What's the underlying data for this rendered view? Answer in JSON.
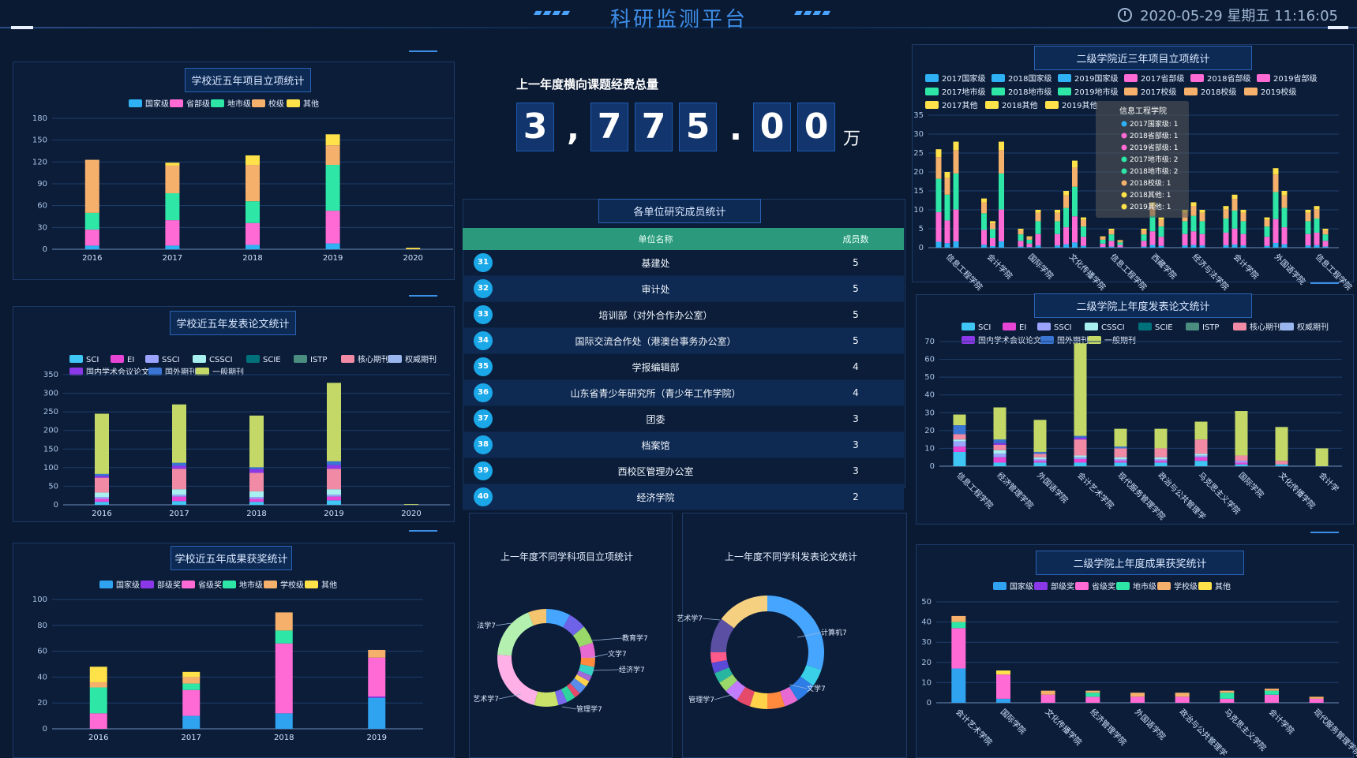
{
  "header": {
    "title": "科研监测平台",
    "datetime": "2020-05-29 星期五 11:16:05"
  },
  "summary": {
    "caption": "上一年度横向课题经费总量",
    "digits": [
      "3",
      ",",
      "7",
      "7",
      "5",
      ".",
      "0",
      "0"
    ],
    "unit": "万"
  },
  "member_table": {
    "title": "各单位研究成员统计",
    "columns": [
      "单位名称",
      "成员数"
    ],
    "rows": [
      {
        "rank": "31",
        "name": "基建处",
        "count": "5"
      },
      {
        "rank": "32",
        "name": "审计处",
        "count": "5"
      },
      {
        "rank": "33",
        "name": "培训部（对外合作办公室）",
        "count": "5"
      },
      {
        "rank": "34",
        "name": "国际交流合作处（港澳台事务办公室）",
        "count": "5"
      },
      {
        "rank": "35",
        "name": "学报编辑部",
        "count": "4"
      },
      {
        "rank": "36",
        "name": "山东省青少年研究所（青少年工作学院）",
        "count": "4"
      },
      {
        "rank": "37",
        "name": "团委",
        "count": "3"
      },
      {
        "rank": "38",
        "name": "档案馆",
        "count": "3"
      },
      {
        "rank": "39",
        "name": "西校区管理办公室",
        "count": "3"
      },
      {
        "rank": "40",
        "name": "经济学院",
        "count": "2"
      }
    ]
  },
  "chart_data": [
    {
      "id": "c1",
      "type": "bar",
      "title": "学校近五年项目立项统计",
      "categories": [
        "2016",
        "2017",
        "2018",
        "2019",
        "2020"
      ],
      "ylim": [
        0,
        180
      ],
      "yticks": [
        0,
        30,
        60,
        90,
        120,
        150,
        180
      ],
      "series": [
        {
          "name": "国家级",
          "color": "#2fb2f5",
          "values": [
            5,
            5,
            6,
            8,
            0
          ]
        },
        {
          "name": "省部级",
          "color": "#ff6ad5",
          "values": [
            22,
            35,
            30,
            45,
            0
          ]
        },
        {
          "name": "地市级",
          "color": "#2ee6a6",
          "values": [
            23,
            37,
            30,
            63,
            0
          ]
        },
        {
          "name": "校级",
          "color": "#f5b06b",
          "values": [
            73,
            38,
            50,
            27,
            0
          ]
        },
        {
          "name": "其他",
          "color": "#ffe14a",
          "values": [
            0,
            4,
            13,
            15,
            2
          ]
        }
      ]
    },
    {
      "id": "c2",
      "type": "bar",
      "title": "学校近五年发表论文统计",
      "categories": [
        "2016",
        "2017",
        "2018",
        "2019",
        "2020"
      ],
      "ylim": [
        0,
        350
      ],
      "yticks": [
        0,
        50,
        100,
        150,
        200,
        250,
        300,
        350
      ],
      "series": [
        {
          "name": "SCI",
          "color": "#3fc6f5",
          "values": [
            8,
            10,
            8,
            12,
            0
          ]
        },
        {
          "name": "EI",
          "color": "#e845d5",
          "values": [
            8,
            12,
            8,
            10,
            0
          ]
        },
        {
          "name": "SSCI",
          "color": "#9aa4ff",
          "values": [
            5,
            5,
            5,
            5,
            0
          ]
        },
        {
          "name": "CSSCI",
          "color": "#a8f0f0",
          "values": [
            12,
            15,
            15,
            15,
            0
          ]
        },
        {
          "name": "SCIE",
          "color": "#00707a",
          "values": [
            0,
            0,
            0,
            0,
            0
          ]
        },
        {
          "name": "ISTP",
          "color": "#4a8d80",
          "values": [
            0,
            0,
            0,
            0,
            0
          ]
        },
        {
          "name": "核心期刊",
          "color": "#f08aa5",
          "values": [
            40,
            55,
            50,
            55,
            0
          ]
        },
        {
          "name": "权威期刊",
          "color": "#9ab6ee",
          "values": [
            0,
            0,
            0,
            0,
            0
          ]
        },
        {
          "name": "国内学术会议论文集",
          "color": "#8b38e8",
          "values": [
            5,
            8,
            10,
            10,
            0
          ]
        },
        {
          "name": "国外期刊",
          "color": "#3a75d4",
          "values": [
            5,
            8,
            5,
            10,
            0
          ]
        },
        {
          "name": "一般期刊",
          "color": "#c4d868",
          "values": [
            162,
            157,
            139,
            211,
            2
          ]
        }
      ]
    },
    {
      "id": "c3",
      "type": "bar",
      "title": "学校近五年成果获奖统计",
      "categories": [
        "2016",
        "2017",
        "2018",
        "2019"
      ],
      "ylim": [
        0,
        100
      ],
      "yticks": [
        0,
        20,
        40,
        60,
        80,
        100
      ],
      "series": [
        {
          "name": "国家级",
          "color": "#2fa2f0",
          "values": [
            0,
            10,
            12,
            24
          ]
        },
        {
          "name": "部级奖",
          "color": "#8b38e8",
          "values": [
            0,
            0,
            0,
            1
          ]
        },
        {
          "name": "省级奖",
          "color": "#ff6ad5",
          "values": [
            12,
            20,
            54,
            30
          ]
        },
        {
          "name": "地市级",
          "color": "#2ee6a6",
          "values": [
            20,
            5,
            10,
            0
          ]
        },
        {
          "name": "学校级",
          "color": "#f5b06b",
          "values": [
            4,
            5,
            14,
            6
          ]
        },
        {
          "name": "其他",
          "color": "#ffe14a",
          "values": [
            12,
            4,
            0,
            0
          ]
        }
      ]
    },
    {
      "id": "c4",
      "type": "bar",
      "title": "二级学院近三年项目立项统计",
      "categories": [
        "信息工程学院",
        "会计学院",
        "国际学院",
        "文化传播学院",
        "信息工程学院",
        "西藏学院",
        "经济与法学院",
        "会计学院",
        "外国语学院",
        "信息工程学院"
      ],
      "ylim": [
        0,
        35
      ],
      "yticks": [
        0,
        5,
        10,
        15,
        20,
        25,
        30,
        35
      ],
      "legend": [
        {
          "name": "2017国家级",
          "color": "#2fb2f5"
        },
        {
          "name": "2018国家级",
          "color": "#2fb2f5"
        },
        {
          "name": "2019国家级",
          "color": "#2fb2f5"
        },
        {
          "name": "2017省部级",
          "color": "#ff6ad5"
        },
        {
          "name": "2018省部级",
          "color": "#ff6ad5"
        },
        {
          "name": "2019省部级",
          "color": "#ff6ad5"
        },
        {
          "name": "2017地市级",
          "color": "#2ee6a6"
        },
        {
          "name": "2018地市级",
          "color": "#2ee6a6"
        },
        {
          "name": "2019地市级",
          "color": "#2ee6a6"
        },
        {
          "name": "2017校级",
          "color": "#f5b06b"
        },
        {
          "name": "2018校级",
          "color": "#f5b06b"
        },
        {
          "name": "2019校级",
          "color": "#f5b06b"
        },
        {
          "name": "2017其他",
          "color": "#ffe14a"
        },
        {
          "name": "2018其他",
          "color": "#ffe14a"
        },
        {
          "name": "2019其他",
          "color": "#ffe14a"
        }
      ],
      "groups": [
        [
          26,
          20,
          28
        ],
        [
          0,
          13,
          7,
          28
        ],
        [
          5,
          3,
          10
        ],
        [
          10,
          15,
          23,
          8
        ],
        [
          3,
          5,
          2
        ],
        [
          5,
          12,
          8
        ],
        [
          10,
          12,
          10
        ],
        [
          11,
          14,
          10
        ],
        [
          8,
          21,
          15
        ],
        [
          10,
          11,
          5
        ]
      ],
      "tooltip": {
        "title": "信息工程学院",
        "items": [
          {
            "label": "2017国家级: 1",
            "color": "#2fb2f5"
          },
          {
            "label": "2018省部级: 1",
            "color": "#ff6ad5"
          },
          {
            "label": "2019省部级: 1",
            "color": "#ff6ad5"
          },
          {
            "label": "2017地市级: 2",
            "color": "#2ee6a6"
          },
          {
            "label": "2018地市级: 2",
            "color": "#2ee6a6"
          },
          {
            "label": "2018校级: 1",
            "color": "#f5b06b"
          },
          {
            "label": "2018其他: 1",
            "color": "#ffe14a"
          },
          {
            "label": "2019其他: 1",
            "color": "#ffe14a"
          }
        ]
      }
    },
    {
      "id": "c5",
      "type": "bar",
      "title": "二级学院上年度发表论文统计",
      "categories": [
        "信息工程学院",
        "经济管理学院",
        "外国语学院",
        "会计艺术学院",
        "现代服务管理学院",
        "政治与公共管理学",
        "马克思主义学院",
        "国际学院",
        "文化传播学院",
        "会计学"
      ],
      "ylim": [
        0,
        70
      ],
      "yticks": [
        0,
        10,
        20,
        30,
        40,
        50,
        60,
        70
      ],
      "series": [
        {
          "name": "SCI",
          "color": "#3fc6f5",
          "values": [
            8,
            2,
            2,
            2,
            2,
            2,
            3,
            1,
            1,
            0
          ]
        },
        {
          "name": "EI",
          "color": "#e845d5",
          "values": [
            3,
            3,
            1,
            2,
            1,
            1,
            2,
            1,
            0,
            0
          ]
        },
        {
          "name": "SSCI",
          "color": "#9aa4ff",
          "values": [
            3,
            2,
            1,
            1,
            1,
            1,
            1,
            1,
            0,
            0
          ]
        },
        {
          "name": "CSSCI",
          "color": "#a8f0f0",
          "values": [
            1,
            2,
            1,
            1,
            1,
            1,
            1,
            0,
            0,
            0
          ]
        },
        {
          "name": "SCIE",
          "color": "#00707a",
          "values": [
            0,
            0,
            0,
            0,
            0,
            0,
            0,
            0,
            0,
            0
          ]
        },
        {
          "name": "ISTP",
          "color": "#4a8d80",
          "values": [
            0,
            0,
            0,
            0,
            0,
            0,
            0,
            0,
            0,
            0
          ]
        },
        {
          "name": "核心期刊",
          "color": "#f08aa5",
          "values": [
            3,
            3,
            2,
            9,
            5,
            5,
            8,
            3,
            2,
            0
          ]
        },
        {
          "name": "权威期刊",
          "color": "#9ab6ee",
          "values": [
            0,
            0,
            0,
            0,
            0,
            0,
            0,
            0,
            0,
            0
          ]
        },
        {
          "name": "国内学术会议论文集",
          "color": "#8b38e8",
          "values": [
            0,
            1,
            0,
            1,
            0,
            0,
            0,
            0,
            0,
            0
          ]
        },
        {
          "name": "国外期刊",
          "color": "#3a75d4",
          "values": [
            5,
            2,
            1,
            1,
            1,
            0,
            0,
            0,
            0,
            0
          ]
        },
        {
          "name": "一般期刊",
          "color": "#c4d868",
          "values": [
            6,
            18,
            18,
            52,
            10,
            11,
            10,
            25,
            19,
            10
          ]
        }
      ]
    },
    {
      "id": "c6",
      "type": "bar",
      "title": "二级学院上年度成果获奖统计",
      "categories": [
        "会计艺术学院",
        "国际学院",
        "文化传播学院",
        "经济管理学院",
        "外国语学院",
        "政治与公共管理学",
        "马克思主义学院",
        "会计学院",
        "现代服务管理学院"
      ],
      "ylim": [
        0,
        50
      ],
      "yticks": [
        0,
        10,
        20,
        30,
        40,
        50
      ],
      "series": [
        {
          "name": "国家级",
          "color": "#2fa2f0",
          "values": [
            17,
            2,
            0,
            0,
            0,
            0,
            0,
            0,
            0
          ]
        },
        {
          "name": "部级奖",
          "color": "#8b38e8",
          "values": [
            0,
            0,
            0,
            0,
            0,
            0,
            0,
            0,
            0
          ]
        },
        {
          "name": "省级奖",
          "color": "#ff6ad5",
          "values": [
            20,
            12,
            4,
            3,
            3,
            3,
            2,
            4,
            2
          ]
        },
        {
          "name": "地市级",
          "color": "#2ee6a6",
          "values": [
            3,
            0,
            0,
            2,
            0,
            0,
            3,
            2,
            0
          ]
        },
        {
          "name": "学校级",
          "color": "#f5b06b",
          "values": [
            3,
            0,
            2,
            1,
            2,
            2,
            1,
            1,
            1
          ]
        },
        {
          "name": "其他",
          "color": "#ffe14a",
          "values": [
            0,
            2,
            0,
            0,
            0,
            0,
            0,
            0,
            0
          ]
        }
      ]
    },
    {
      "id": "d1",
      "type": "pie",
      "title": "上一年度不同学科项目立项统计",
      "labels": [
        "法学7",
        "艺术学7",
        "教育学7",
        "文学7",
        "经济学7",
        "管理学7"
      ],
      "values": [
        8,
        6,
        6,
        5,
        3,
        3,
        2,
        2,
        3,
        2,
        3,
        3,
        8,
        22,
        18,
        6
      ],
      "colors": [
        "#46a5ff",
        "#6e62e8",
        "#9ad86a",
        "#e66ad2",
        "#ff8a3d",
        "#37d0c6",
        "#a16ad8",
        "#ffd24a",
        "#5a8de8",
        "#e64a6a",
        "#2ed3a0",
        "#7a6af0",
        "#c9e26a",
        "#ffb0e6",
        "#b4f0b0",
        "#f5c46e"
      ]
    },
    {
      "id": "d2",
      "type": "pie",
      "title": "上一年度不同学科发表论文统计",
      "labels": [
        "艺术学7",
        "管理学7",
        "计算机7",
        "文学7"
      ],
      "values": [
        30,
        5,
        6,
        4,
        5,
        5,
        4,
        4,
        3,
        3,
        3,
        3,
        10,
        15
      ],
      "colors": [
        "#46a5ff",
        "#3ad0e8",
        "#2e7ce6",
        "#e66ad2",
        "#ff8a3d",
        "#ffd24a",
        "#e64a6a",
        "#c27aff",
        "#9ad86a",
        "#29b6a0",
        "#5a4ad8",
        "#ff5a8a",
        "#5b4fa3",
        "#f5d080"
      ]
    }
  ]
}
